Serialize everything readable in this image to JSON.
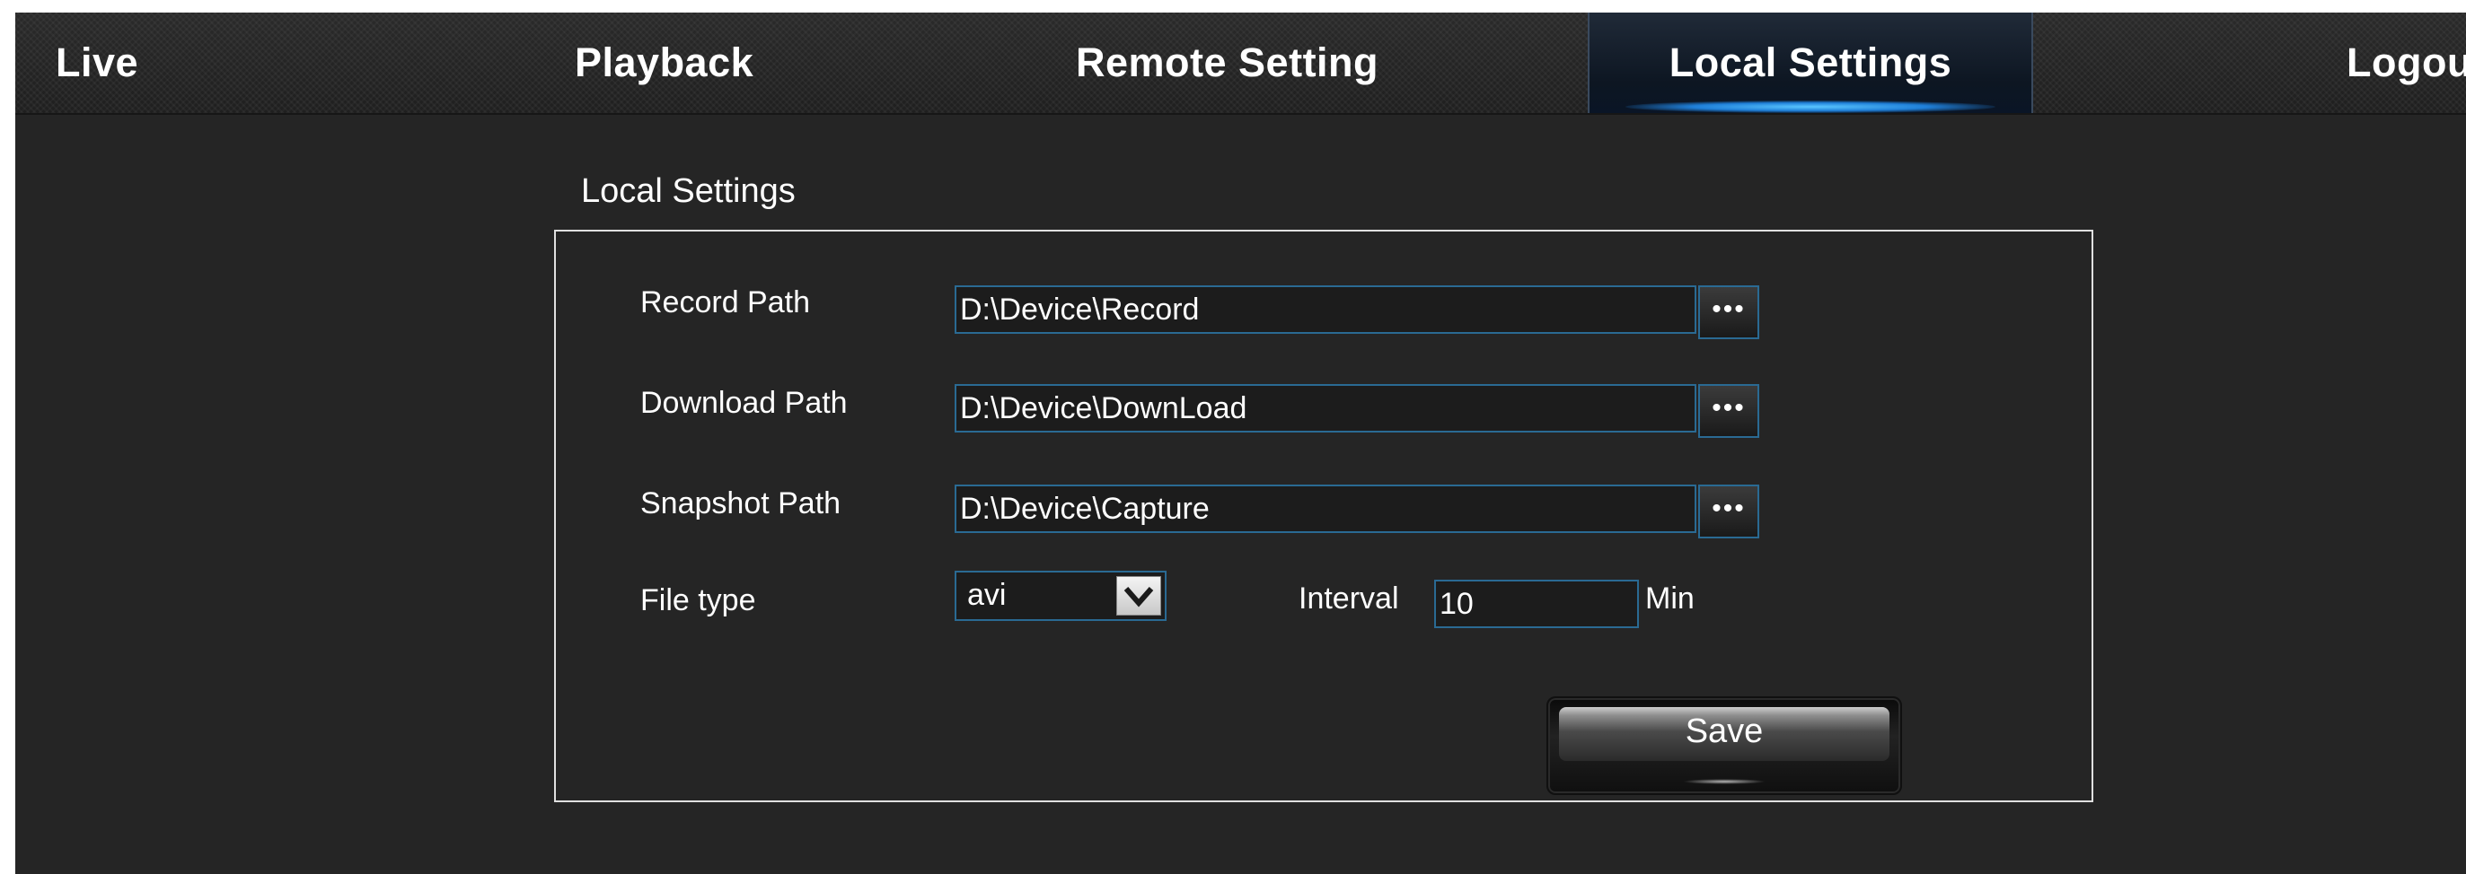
{
  "nav": {
    "live": "Live",
    "playback": "Playback",
    "remote_setting": "Remote Setting",
    "local_settings": "Local Settings",
    "logout": "Logout",
    "active": "local_settings"
  },
  "section": {
    "title": "Local Settings"
  },
  "form": {
    "record_path": {
      "label": "Record Path",
      "value": "D:\\Device\\Record",
      "browse_label": "•••"
    },
    "download_path": {
      "label": "Download Path",
      "value": "D:\\Device\\DownLoad",
      "browse_label": "•••"
    },
    "snapshot_path": {
      "label": "Snapshot Path",
      "value": "D:\\Device\\Capture",
      "browse_label": "•••"
    },
    "file_type": {
      "label": "File type",
      "value": "avi"
    },
    "interval": {
      "label": "Interval",
      "value": "10",
      "unit": "Min"
    },
    "save_label": "Save"
  },
  "colors": {
    "background": "#252525",
    "accent_border": "#2a6a93",
    "active_tab_glow": "#5ac6ff",
    "text": "#ffffff"
  }
}
